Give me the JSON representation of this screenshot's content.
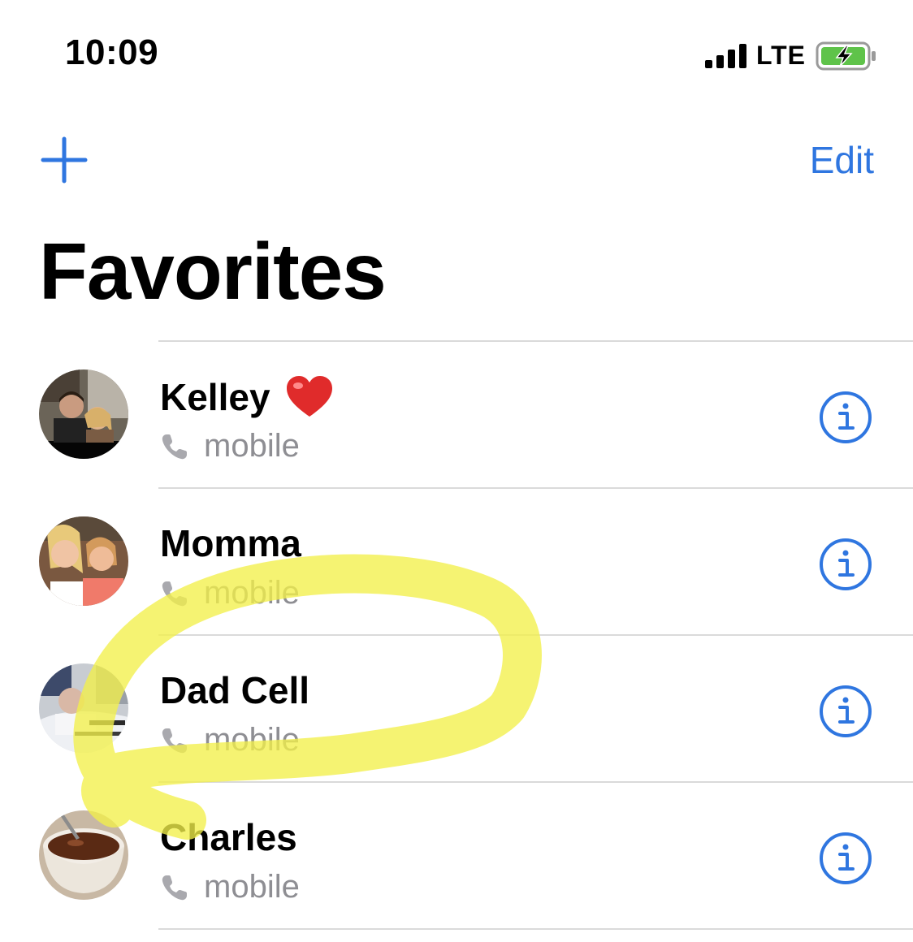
{
  "status_bar": {
    "time": "10:09",
    "network": "LTE",
    "icons": [
      "signal-bars-icon",
      "battery-charging-icon"
    ]
  },
  "nav": {
    "add_icon": "plus-icon",
    "edit_label": "Edit"
  },
  "title": "Favorites",
  "favorites": [
    {
      "name": "Kelley",
      "emoji": "heart",
      "label": "mobile",
      "avatar": "couple-photo"
    },
    {
      "name": "Momma",
      "emoji": "",
      "label": "mobile",
      "avatar": "two-women-photo"
    },
    {
      "name": "Dad Cell",
      "emoji": "",
      "label": "mobile",
      "avatar": "man-in-bed-photo"
    },
    {
      "name": "Charles",
      "emoji": "",
      "label": "mobile",
      "avatar": "bowl-photo"
    }
  ],
  "colors": {
    "accent": "#2f76e0",
    "secondary_text": "#8e8e93",
    "divider": "#dadada",
    "highlight": "#f2f04a",
    "battery_fill": "#5fc34a"
  }
}
